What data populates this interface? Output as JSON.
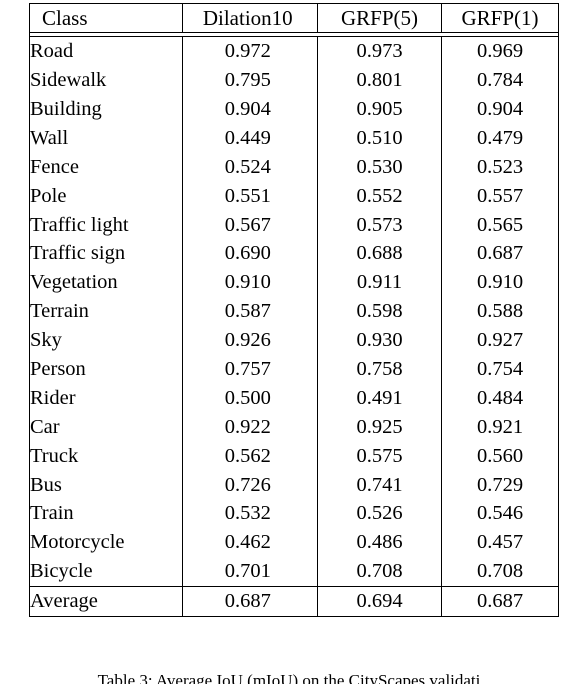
{
  "table": {
    "columns": [
      "Class",
      "Dilation10",
      "GRFP(5)",
      "GRFP(1)"
    ],
    "rows": [
      {
        "class": "Road",
        "dilation10": "0.972",
        "grfp5": "0.973",
        "grfp1": "0.969"
      },
      {
        "class": "Sidewalk",
        "dilation10": "0.795",
        "grfp5": "0.801",
        "grfp1": "0.784"
      },
      {
        "class": "Building",
        "dilation10": "0.904",
        "grfp5": "0.905",
        "grfp1": "0.904"
      },
      {
        "class": "Wall",
        "dilation10": "0.449",
        "grfp5": "0.510",
        "grfp1": "0.479"
      },
      {
        "class": "Fence",
        "dilation10": "0.524",
        "grfp5": "0.530",
        "grfp1": "0.523"
      },
      {
        "class": "Pole",
        "dilation10": "0.551",
        "grfp5": "0.552",
        "grfp1": "0.557"
      },
      {
        "class": "Traffic light",
        "dilation10": "0.567",
        "grfp5": "0.573",
        "grfp1": "0.565"
      },
      {
        "class": "Traffic sign",
        "dilation10": "0.690",
        "grfp5": "0.688",
        "grfp1": "0.687"
      },
      {
        "class": "Vegetation",
        "dilation10": "0.910",
        "grfp5": "0.911",
        "grfp1": "0.910"
      },
      {
        "class": "Terrain",
        "dilation10": "0.587",
        "grfp5": "0.598",
        "grfp1": "0.588"
      },
      {
        "class": "Sky",
        "dilation10": "0.926",
        "grfp5": "0.930",
        "grfp1": "0.927"
      },
      {
        "class": "Person",
        "dilation10": "0.757",
        "grfp5": "0.758",
        "grfp1": "0.754"
      },
      {
        "class": "Rider",
        "dilation10": "0.500",
        "grfp5": "0.491",
        "grfp1": "0.484"
      },
      {
        "class": "Car",
        "dilation10": "0.922",
        "grfp5": "0.925",
        "grfp1": "0.921"
      },
      {
        "class": "Truck",
        "dilation10": "0.562",
        "grfp5": "0.575",
        "grfp1": "0.560"
      },
      {
        "class": "Bus",
        "dilation10": "0.726",
        "grfp5": "0.741",
        "grfp1": "0.729"
      },
      {
        "class": "Train",
        "dilation10": "0.532",
        "grfp5": "0.526",
        "grfp1": "0.546"
      },
      {
        "class": "Motorcycle",
        "dilation10": "0.462",
        "grfp5": "0.486",
        "grfp1": "0.457"
      },
      {
        "class": "Bicycle",
        "dilation10": "0.701",
        "grfp5": "0.708",
        "grfp1": "0.708"
      }
    ],
    "summary": {
      "class": "Average",
      "dilation10": "0.687",
      "grfp5": "0.694",
      "grfp1": "0.687"
    }
  },
  "caption": "Table 3: Average IoU (mIoU) on the CityScapes validati",
  "chart_data": {
    "type": "table",
    "title": "Average IoU (mIoU) on the CityScapes validation set",
    "categories": [
      "Road",
      "Sidewalk",
      "Building",
      "Wall",
      "Fence",
      "Pole",
      "Traffic light",
      "Traffic sign",
      "Vegetation",
      "Terrain",
      "Sky",
      "Person",
      "Rider",
      "Car",
      "Truck",
      "Bus",
      "Train",
      "Motorcycle",
      "Bicycle",
      "Average"
    ],
    "series": [
      {
        "name": "Dilation10",
        "values": [
          0.972,
          0.795,
          0.904,
          0.449,
          0.524,
          0.551,
          0.567,
          0.69,
          0.91,
          0.587,
          0.926,
          0.757,
          0.5,
          0.922,
          0.562,
          0.726,
          0.532,
          0.462,
          0.701,
          0.687
        ]
      },
      {
        "name": "GRFP(5)",
        "values": [
          0.973,
          0.801,
          0.905,
          0.51,
          0.53,
          0.552,
          0.573,
          0.688,
          0.911,
          0.598,
          0.93,
          0.758,
          0.491,
          0.925,
          0.575,
          0.741,
          0.526,
          0.486,
          0.708,
          0.694
        ]
      },
      {
        "name": "GRFP(1)",
        "values": [
          0.969,
          0.784,
          0.904,
          0.479,
          0.523,
          0.557,
          0.565,
          0.687,
          0.91,
          0.588,
          0.927,
          0.754,
          0.484,
          0.921,
          0.56,
          0.729,
          0.546,
          0.457,
          0.708,
          0.687
        ]
      }
    ],
    "xlabel": "Class",
    "ylabel": "IoU",
    "ylim": [
      0,
      1
    ],
    "grid": false,
    "legend_position": "header-row"
  }
}
